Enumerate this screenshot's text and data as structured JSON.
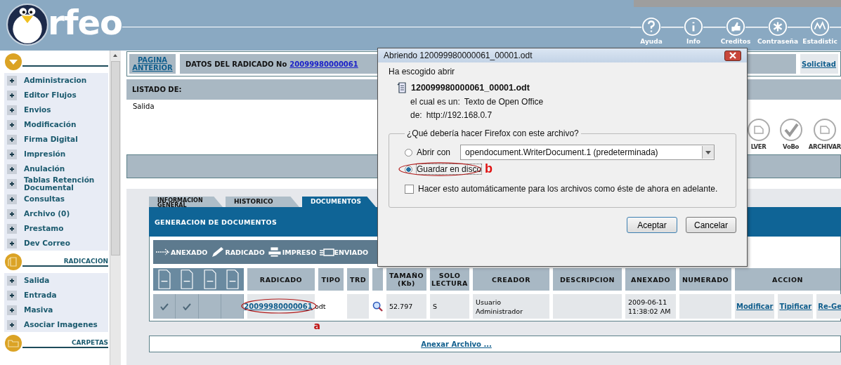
{
  "header": {
    "logo": "rfeo",
    "nav": [
      {
        "label": "Ayuda"
      },
      {
        "label": "Info"
      },
      {
        "label": "Creditos"
      },
      {
        "label": "Contraseña"
      },
      {
        "label": "Estadistic"
      }
    ]
  },
  "sidebar": {
    "sections": [
      {
        "items": [
          "Administracion",
          "Editor Flujos",
          "Envios",
          "Modificación",
          "Firma Digital",
          "Impresión",
          "Anulación",
          "Tablas Retención Documental",
          "Consultas",
          "Archivo (0)",
          "Prestamo",
          "Dev Correo"
        ]
      },
      {
        "title": "RADICACION",
        "items": [
          "Salida",
          "Entrada",
          "Masiva",
          "Asociar Imagenes"
        ]
      },
      {
        "title": "CARPETAS"
      }
    ]
  },
  "record": {
    "back_link": "PAGINA ANTERIOR",
    "heading": "DATOS DEL RADICADO No",
    "number": "20099980000061",
    "side_link": "Solicitad"
  },
  "listing": {
    "label": "LISTADO DE:",
    "value": "Salida"
  },
  "actions": [
    {
      "label": "LVER"
    },
    {
      "label": "VoBo"
    },
    {
      "label": "ARCHIVAR"
    }
  ],
  "tabs": [
    {
      "label": "INFORMACION GENERAL",
      "selected": false
    },
    {
      "label": "HISTORICO",
      "selected": false
    },
    {
      "label": "DOCUMENTOS",
      "selected": true
    }
  ],
  "panel_title": "GENERACION DE DOCUMENTOS",
  "legend": [
    "ANEXADO",
    "RADICADO",
    "IMPRESO",
    "ENVIADO"
  ],
  "table": {
    "columns": [
      "RADICADO",
      "TIPO",
      "TRD",
      "TAMAÑO (Kb)",
      "SOLO LECTURA",
      "CREADOR",
      "DESCRIPCION",
      "ANEXADO",
      "NUMERADO",
      "ACCION"
    ],
    "rows": [
      {
        "states": [
          {
            "checked": true
          },
          {
            "checked": true
          },
          {
            "checked": false
          },
          {
            "checked": false
          }
        ],
        "radicado": "20099980000061",
        "tipo": "odt",
        "size": "52.797",
        "read_only": "S",
        "creator": "Usuario Administrador",
        "date": "2009-06-11 11:38:02 AM",
        "actions": [
          "Modificar",
          "Tipificar",
          "Re-Ge"
        ]
      }
    ]
  },
  "attach_link": "Anexar Archivo ...",
  "marks": [
    "a",
    "b"
  ],
  "dialog": {
    "title": "Abriendo 120099980000061_00001.odt",
    "intro": "Ha escogido abrir",
    "file": "120099980000061_00001.odt",
    "type_label": "el cual es un:",
    "type": "Texto de Open Office",
    "from_label": "de:",
    "from": "http://192.168.0.7",
    "group_label": "¿Qué debería hacer Firefox con este archivo?",
    "options": [
      {
        "label": "Abrir con",
        "selected": false
      },
      {
        "label": "Guardar en disco",
        "selected": true
      }
    ],
    "app": "opendocument.WriterDocument.1 (predeterminada)",
    "remember": {
      "label": "Hacer esto automáticamente para los archivos como éste de ahora en adelante.",
      "checked": false
    },
    "buttons": [
      "Aceptar",
      "Cancelar"
    ]
  }
}
